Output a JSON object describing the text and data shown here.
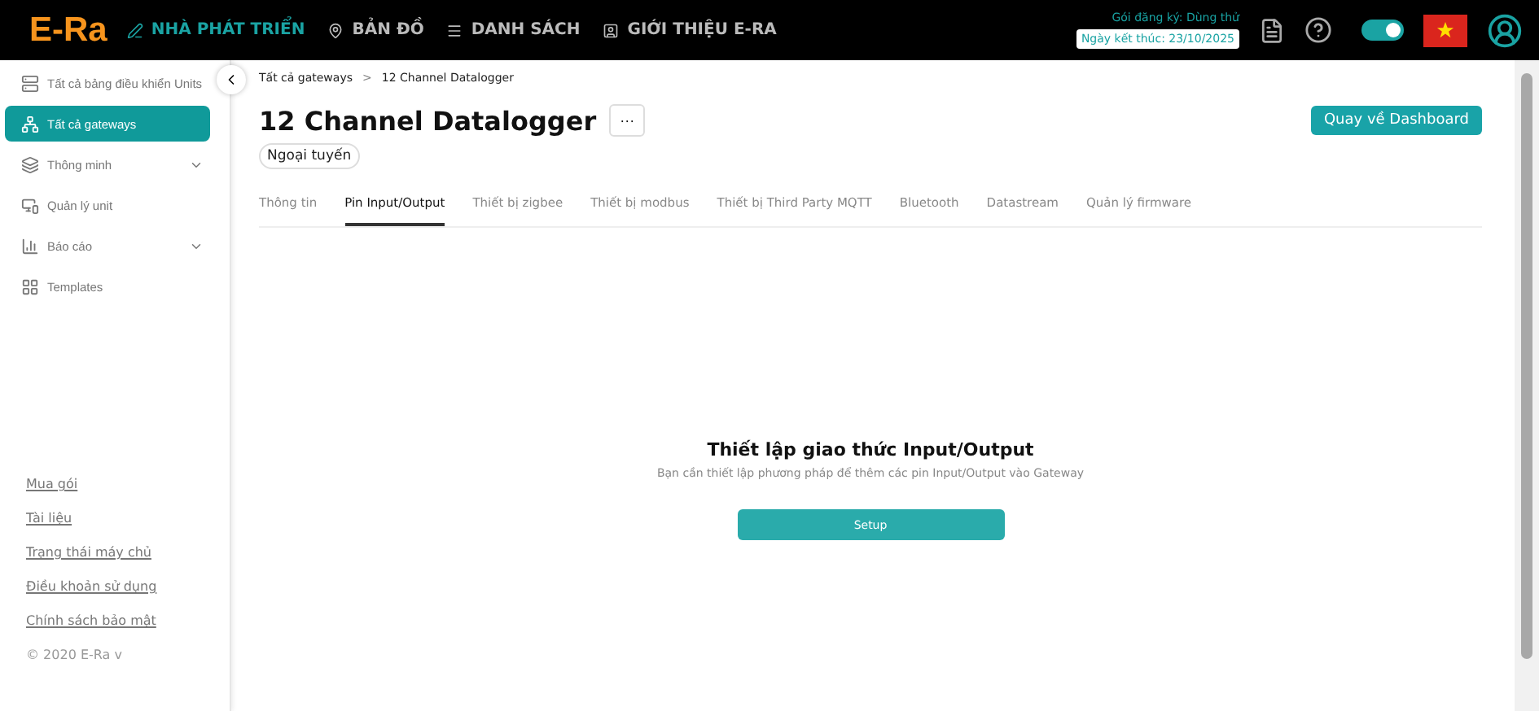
{
  "topbar": {
    "logo": "E-Ra",
    "nav": [
      {
        "label": "NHÀ PHÁT TRIỂN",
        "selected": true
      },
      {
        "label": "BẢN ĐỒ",
        "selected": false
      },
      {
        "label": "DANH SÁCH",
        "selected": false
      },
      {
        "label": "GIỚI THIỆU E-RA",
        "selected": false
      }
    ],
    "plan": "Gói đăng ký: Dùng thử",
    "expiry": "Ngày kết thúc: 23/10/2025",
    "theme_toggle": {
      "on": true
    }
  },
  "sidebar": {
    "items": [
      {
        "label": "Tất cả bảng điều khiển Units",
        "selected": false,
        "expandable": false
      },
      {
        "label": "Tất cả gateways",
        "selected": true,
        "expandable": false
      },
      {
        "label": "Thông minh",
        "selected": false,
        "expandable": true
      },
      {
        "label": "Quản lý unit",
        "selected": false,
        "expandable": false
      },
      {
        "label": "Báo cáo",
        "selected": false,
        "expandable": true
      },
      {
        "label": "Templates",
        "selected": false,
        "expandable": false
      }
    ],
    "links": [
      "Mua gói",
      "Tài liệu",
      "Trạng thái máy chủ",
      "Điều khoản sử dụng",
      "Chính sách bảo mật"
    ],
    "copyright": "© 2020 E-Ra v"
  },
  "breadcrumb": [
    "Tất cả gateways",
    "12 Channel Datalogger"
  ],
  "breadcrumb_separator": ">",
  "title": "12 Channel Datalogger",
  "more_button": "···",
  "status": "Ngoại tuyến",
  "back_button": "Quay về Dashboard",
  "tabs": [
    {
      "label": "Thông tin",
      "selected": false
    },
    {
      "label": "Pin Input/Output",
      "selected": true
    },
    {
      "label": "Thiết bị zigbee",
      "selected": false
    },
    {
      "label": "Thiết bị modbus",
      "selected": false
    },
    {
      "label": "Thiết bị Third Party MQTT",
      "selected": false
    },
    {
      "label": "Bluetooth",
      "selected": false
    },
    {
      "label": "Datastream",
      "selected": false
    },
    {
      "label": "Quản lý firmware",
      "selected": false
    }
  ],
  "empty_state": {
    "heading": "Thiết lập giao thức Input/Output",
    "description": "Bạn cần thiết lập phương pháp để thêm các pin Input/Output vào Gateway",
    "button": "Setup"
  }
}
